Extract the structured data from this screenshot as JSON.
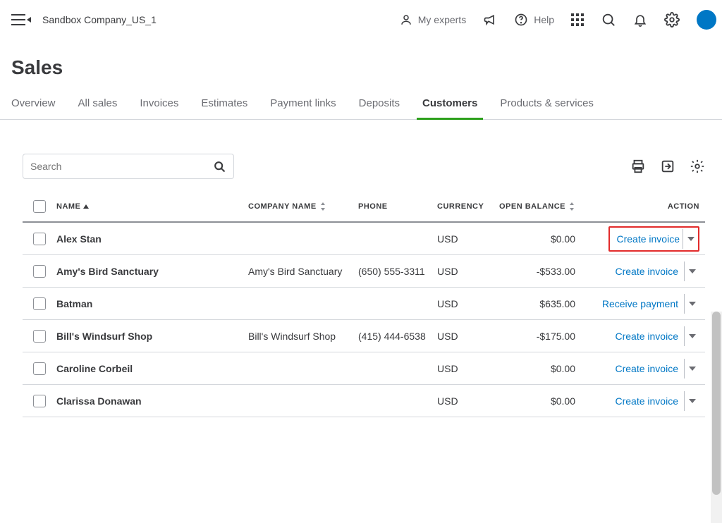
{
  "header": {
    "company": "Sandbox Company_US_1",
    "myExperts": "My experts",
    "help": "Help"
  },
  "page": {
    "title": "Sales"
  },
  "tabs": [
    {
      "label": "Overview",
      "active": false
    },
    {
      "label": "All sales",
      "active": false
    },
    {
      "label": "Invoices",
      "active": false
    },
    {
      "label": "Estimates",
      "active": false
    },
    {
      "label": "Payment links",
      "active": false
    },
    {
      "label": "Deposits",
      "active": false
    },
    {
      "label": "Customers",
      "active": true
    },
    {
      "label": "Products & services",
      "active": false
    }
  ],
  "search": {
    "placeholder": "Search"
  },
  "columns": {
    "name": "NAME",
    "company": "COMPANY NAME",
    "phone": "PHONE",
    "currency": "CURRENCY",
    "balance": "OPEN BALANCE",
    "action": "ACTION"
  },
  "rows": [
    {
      "name": "Alex Stan",
      "company": "",
      "phone": "",
      "currency": "USD",
      "balance": "$0.00",
      "action": "Create invoice",
      "highlight": true
    },
    {
      "name": "Amy's Bird Sanctuary",
      "company": "Amy's Bird Sanctuary",
      "phone": "(650) 555-3311",
      "currency": "USD",
      "balance": "-$533.00",
      "action": "Create invoice",
      "highlight": false
    },
    {
      "name": "Batman",
      "company": "",
      "phone": "",
      "currency": "USD",
      "balance": "$635.00",
      "action": "Receive payment",
      "highlight": false
    },
    {
      "name": "Bill's Windsurf Shop",
      "company": "Bill's Windsurf Shop",
      "phone": "(415) 444-6538",
      "currency": "USD",
      "balance": "-$175.00",
      "action": "Create invoice",
      "highlight": false
    },
    {
      "name": "Caroline Corbeil",
      "company": "",
      "phone": "",
      "currency": "USD",
      "balance": "$0.00",
      "action": "Create invoice",
      "highlight": false
    },
    {
      "name": "Clarissa Donawan",
      "company": "",
      "phone": "",
      "currency": "USD",
      "balance": "$0.00",
      "action": "Create invoice",
      "highlight": false
    }
  ]
}
